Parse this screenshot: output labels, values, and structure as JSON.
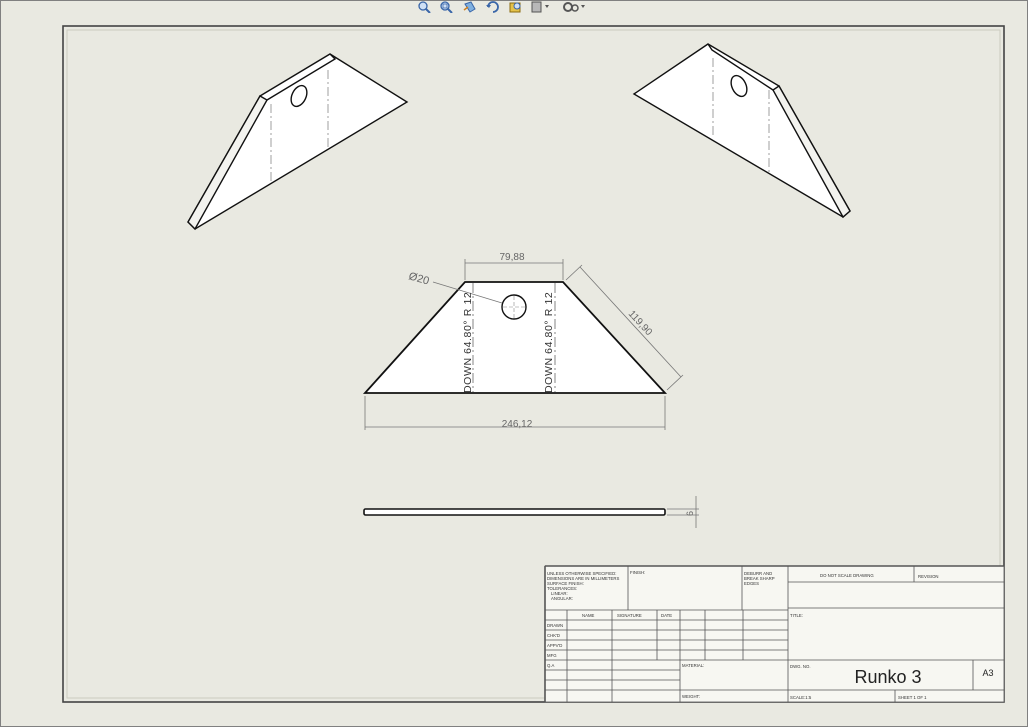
{
  "toolbar": {
    "icons": [
      "zoom-to-fit-icon",
      "zoom-area-icon",
      "previous-view-icon",
      "rotate-view-icon",
      "pan-view-icon",
      "display-style-icon",
      "view-settings-icon"
    ]
  },
  "drawing": {
    "dimensions": {
      "top_width": "79,88",
      "hole_diameter": "Ø20",
      "slant_length": "119,90",
      "bottom_width": "246,12",
      "thickness": "6"
    },
    "bend_notes": {
      "left": "DOWN  64.80°  R 12",
      "right": "DOWN  64.80°  R 12"
    }
  },
  "title_block": {
    "general_notes": [
      "UNLESS OTHERWISE SPECIFIED:",
      "DIMENSIONS ARE IN MILLIMETERS",
      "SURFACE FINISH:",
      "TOLERANCES:",
      "LINEAR:",
      "ANGULAR:"
    ],
    "finish_label": "FINISH:",
    "deburr_label": [
      "DEBURR AND",
      "BREAK SHARP",
      "EDGES"
    ],
    "do_not_scale": "DO NOT SCALE DRAWING",
    "revision_label": "REVISION",
    "title_label": "TITLE:",
    "col_headers": [
      "NAME",
      "SIGNATURE",
      "DATE"
    ],
    "row_labels": [
      "DRAWN",
      "CHK'D",
      "APPV'D",
      "MFG",
      "Q.A"
    ],
    "material_label": "MATERIAL:",
    "dwg_no_label": "DWG. NO.",
    "drawing_number": "Runko 3",
    "sheet_size": "A3",
    "weight_label": "WEIGHT:",
    "scale_label": "SCALE:1:5",
    "sheet_label": "SHEET 1 OF 1"
  }
}
